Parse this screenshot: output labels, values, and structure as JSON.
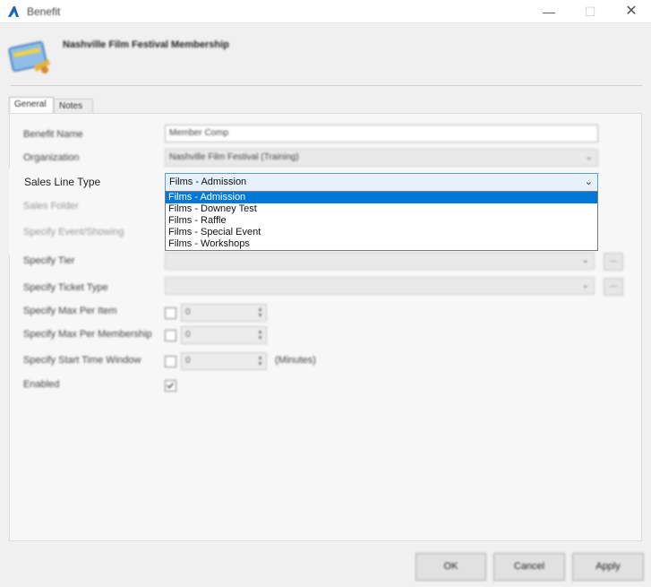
{
  "window": {
    "title": "Benefit",
    "minimize": "—",
    "maximize": "☐",
    "close": "✕"
  },
  "header": {
    "title": "Nashville Film Festival Membership"
  },
  "tabs": [
    {
      "label": "General",
      "active": true
    },
    {
      "label": "Notes",
      "active": false
    }
  ],
  "form": {
    "benefit_name": {
      "label": "Benefit Name",
      "value": "Member Comp"
    },
    "organization": {
      "label": "Organization",
      "value": "Nashville Film Festival (Training)"
    },
    "sales_line_type": {
      "label": "Sales Line Type",
      "value": "Films - Admission",
      "options": [
        "Films - Admission",
        "Films - Downey Test",
        "Films - Raffle",
        "Films - Special Event",
        "Films - Workshops"
      ],
      "selected_index": 0
    },
    "sales_folder": {
      "label": "Sales Folder"
    },
    "specify_event": {
      "label": "Specify Event/Showing"
    },
    "specify_tier": {
      "label": "Specify Tier",
      "value": ""
    },
    "specify_ticket_type": {
      "label": "Specify Ticket Type",
      "value": ""
    },
    "max_per_item": {
      "label": "Specify Max Per Item",
      "value": "0",
      "checked": false
    },
    "max_per_membership": {
      "label": "Specify Max Per Membership",
      "value": "0",
      "checked": false
    },
    "start_time_window": {
      "label": "Specify Start Time Window",
      "value": "0",
      "checked": false,
      "unit": "(Minutes)"
    },
    "enabled": {
      "label": "Enabled",
      "checked": true
    }
  },
  "buttons": {
    "ellipsis": "...",
    "ok": "OK",
    "cancel": "Cancel",
    "apply": "Apply"
  },
  "colors": {
    "accent": "#0078d7",
    "combo_focus_bg": "#e5f1fb",
    "combo_focus_border": "#569de5"
  }
}
